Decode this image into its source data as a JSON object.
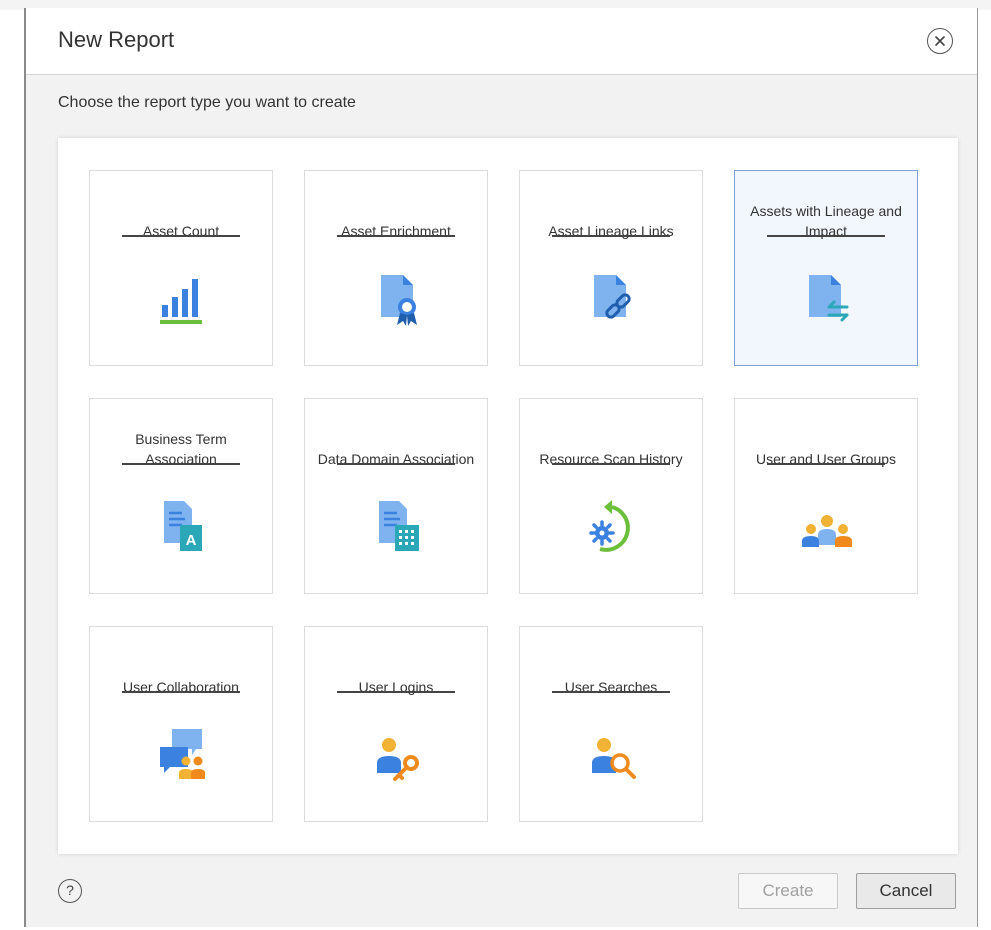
{
  "dialog": {
    "title": "New Report",
    "subtitle": "Choose the report type you want to create",
    "close_icon": "close-icon",
    "help_label": "?",
    "create_label": "Create",
    "cancel_label": "Cancel"
  },
  "colors": {
    "accent_blue": "#3b82e0",
    "light_blue": "#7fb3f0",
    "green": "#6cbf3a",
    "orange": "#f08a1c",
    "teal": "#2aa8b8",
    "yellow": "#f2b233",
    "selected_border": "#7ba1d6"
  },
  "report_types": [
    {
      "label": "Asset Count",
      "icon": "bar-chart-icon",
      "selected": false
    },
    {
      "label": "Asset Enrichment",
      "icon": "document-award-icon",
      "selected": false
    },
    {
      "label": "Asset Lineage Links",
      "icon": "document-link-icon",
      "selected": false
    },
    {
      "label": "Assets with Lineage and Impact",
      "icon": "document-exchange-icon",
      "selected": true
    },
    {
      "label": "Business Term Association",
      "icon": "document-glossary-icon",
      "selected": false
    },
    {
      "label": "Data Domain Association",
      "icon": "document-grid-icon",
      "selected": false
    },
    {
      "label": "Resource Scan History",
      "icon": "gear-history-icon",
      "selected": false
    },
    {
      "label": "User and User Groups",
      "icon": "user-group-icon",
      "selected": false
    },
    {
      "label": "User Collaboration",
      "icon": "chat-users-icon",
      "selected": false
    },
    {
      "label": "User Logins",
      "icon": "user-key-icon",
      "selected": false
    },
    {
      "label": "User Searches",
      "icon": "user-search-icon",
      "selected": false
    }
  ]
}
